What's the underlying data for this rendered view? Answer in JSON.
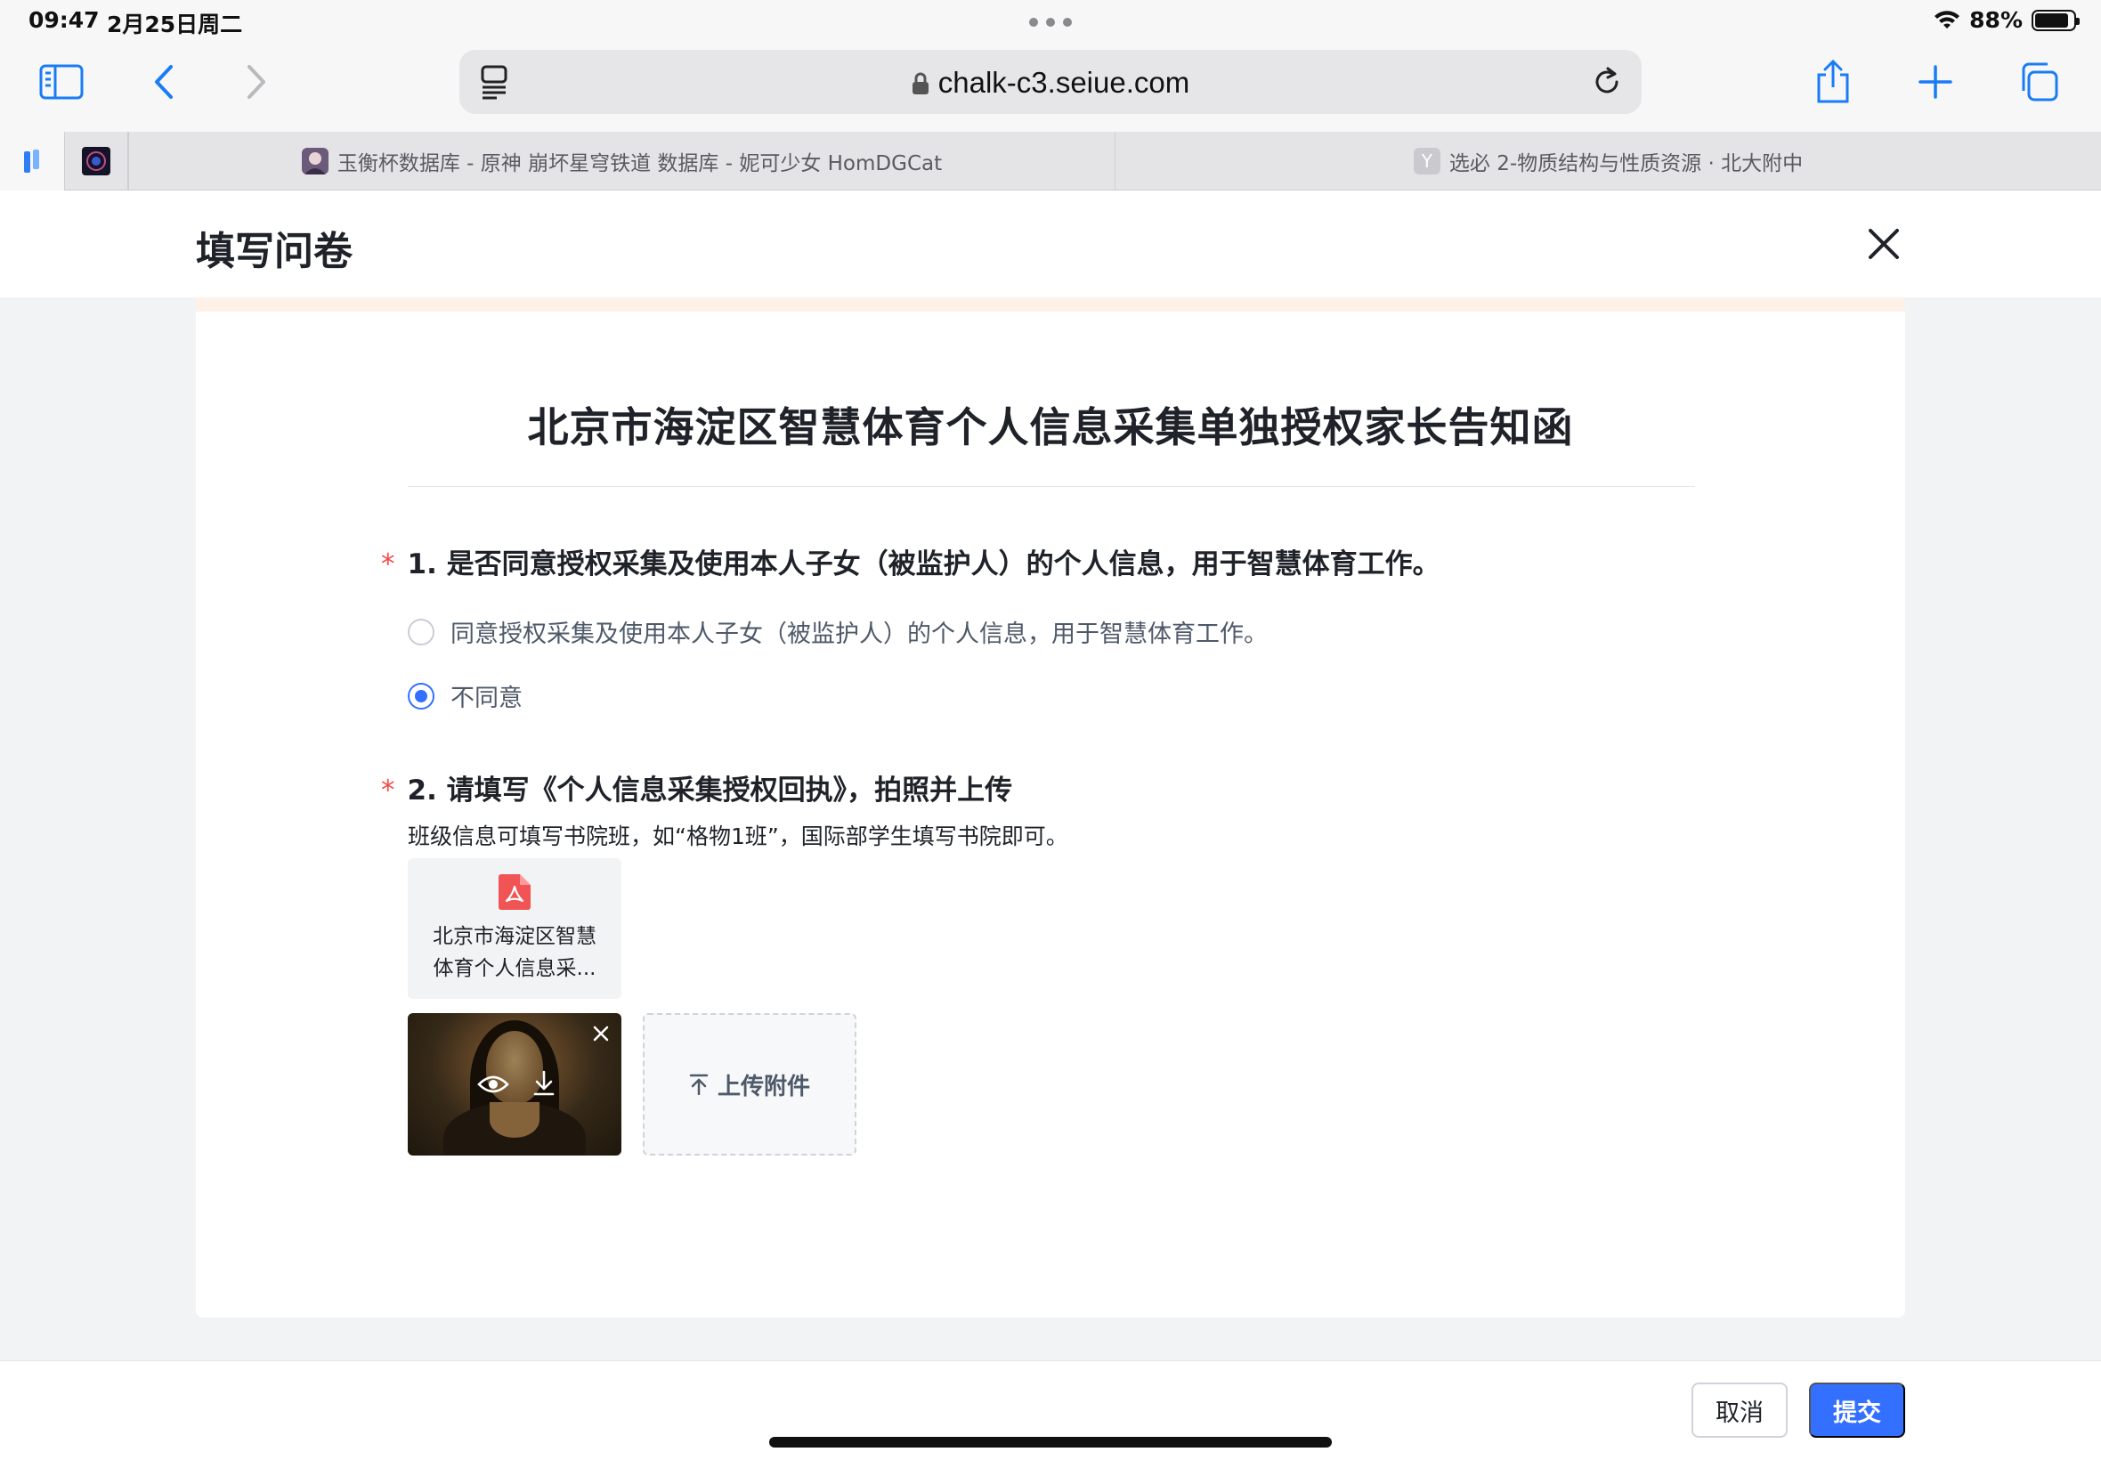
{
  "status_bar": {
    "time": "09:47",
    "date": "2月25日周二",
    "battery": "88%",
    "battery_level": 0.88
  },
  "browser": {
    "url": "chalk-c3.seiue.com",
    "tabs": [
      {
        "title": "玉衡杯数据库 - 原神 崩坏星穹铁道 数据库 - 妮可少女 HomDGCat"
      },
      {
        "title": "选必 2-物质结构与性质资源 · 北大附中",
        "favicon_letter": "Y"
      }
    ]
  },
  "modal": {
    "title": "填写问卷"
  },
  "form": {
    "title": "北京市海淀区智慧体育个人信息采集单独授权家长告知函",
    "q1": {
      "required_mark": "*",
      "label": "1. 是否同意授权采集及使用本人子女（被监护人）的个人信息，用于智慧体育工作。",
      "options": [
        {
          "label": "同意授权采集及使用本人子女（被监护人）的个人信息，用于智慧体育工作。",
          "checked": false
        },
        {
          "label": "不同意",
          "checked": true
        }
      ]
    },
    "q2": {
      "required_mark": "*",
      "label": "2. 请填写《个人信息采集授权回执》，拍照并上传",
      "hint": "班级信息可填写书院班，如“格物1班”，国际部学生填写书院即可。",
      "attachment_name": "北京市海淀区智慧体育个人信息采...",
      "upload_label": "上传附件"
    }
  },
  "footer": {
    "cancel_label": "取消",
    "submit_label": "提交"
  },
  "colors": {
    "primary": "#3370ff",
    "required": "#f54a45",
    "safari_blue": "#1a7cf5"
  }
}
